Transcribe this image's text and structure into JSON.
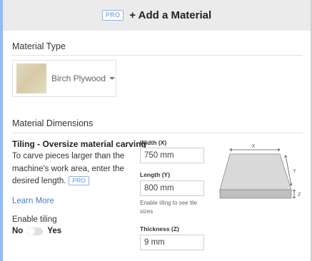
{
  "header": {
    "pro_badge": "PRO",
    "title": "+ Add a Material"
  },
  "material_type": {
    "label": "Material Type",
    "selected": "Birch Plywood"
  },
  "dimensions": {
    "label": "Material Dimensions",
    "tiling_title": "Tiling - Oversize material carving",
    "tiling_description": "To carve pieces larger than the machine's work area, enter the desired length.",
    "tiling_pro_badge": "PRO",
    "learn_more": "Learn More",
    "enable_tiling_label": "Enable tiling",
    "toggle_off": "No",
    "toggle_on": "Yes",
    "tiling_enabled": false,
    "width_label": "Width (X)",
    "width_value": "750 mm",
    "length_label": "Length (Y)",
    "length_value": "800 mm",
    "length_hint": "Enable tiling to see tile sizes",
    "thickness_label": "Thickness (Z)",
    "thickness_value": "9 mm"
  },
  "diagram": {
    "x_label": "X",
    "y_label": "Y",
    "z_label": "Z"
  },
  "colors": {
    "accent_link": "#4a7fc1",
    "pro_badge": "#5b8fd0",
    "header_bg": "#ebebeb"
  }
}
